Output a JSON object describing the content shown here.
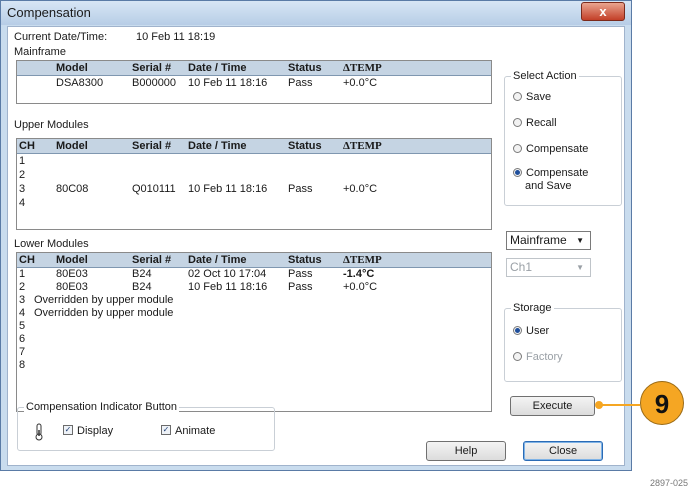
{
  "window": {
    "title": "Compensation",
    "close_glyph": "x"
  },
  "current_datetime": {
    "label": "Current Date/Time:",
    "value": "10 Feb 11 18:19"
  },
  "mainframe": {
    "label": "Mainframe",
    "headers": [
      "Model",
      "Serial #",
      "Date / Time",
      "Status",
      "ΔTEMP"
    ],
    "row": {
      "model": "DSA8300",
      "serial": "B000000",
      "datetime": "10 Feb 11 18:16",
      "status": "Pass",
      "temp": "+0.0°C"
    }
  },
  "upper_modules": {
    "label": "Upper Modules",
    "headers": [
      "CH",
      "Model",
      "Serial #",
      "Date / Time",
      "Status",
      "ΔTEMP"
    ],
    "rows": [
      {
        "ch": "1",
        "model": "",
        "serial": "",
        "datetime": "",
        "status": "",
        "temp": ""
      },
      {
        "ch": "2",
        "model": "",
        "serial": "",
        "datetime": "",
        "status": "",
        "temp": ""
      },
      {
        "ch": "3",
        "model": "80C08",
        "serial": "Q010111",
        "datetime": "10 Feb 11 18:16",
        "status": "Pass",
        "temp": "+0.0°C"
      },
      {
        "ch": "4",
        "model": "",
        "serial": "",
        "datetime": "",
        "status": "",
        "temp": ""
      }
    ]
  },
  "lower_modules": {
    "label": "Lower Modules",
    "headers": [
      "CH",
      "Model",
      "Serial #",
      "Date / Time",
      "Status",
      "ΔTEMP"
    ],
    "rows": [
      {
        "ch": "1",
        "model": "80E03",
        "serial": "B24",
        "datetime": "02 Oct 10 17:04",
        "status": "Pass",
        "temp": "-1.4°C"
      },
      {
        "ch": "2",
        "model": "80E03",
        "serial": "B24",
        "datetime": "10 Feb 11 18:16",
        "status": "Pass",
        "temp": "+0.0°C"
      },
      {
        "ch": "3",
        "model": "Overridden by upper module",
        "serial": "",
        "datetime": "",
        "status": "",
        "temp": ""
      },
      {
        "ch": "4",
        "model": "Overridden by upper module",
        "serial": "",
        "datetime": "",
        "status": "",
        "temp": ""
      },
      {
        "ch": "5",
        "model": "",
        "serial": "",
        "datetime": "",
        "status": "",
        "temp": ""
      },
      {
        "ch": "6",
        "model": "",
        "serial": "",
        "datetime": "",
        "status": "",
        "temp": ""
      },
      {
        "ch": "7",
        "model": "",
        "serial": "",
        "datetime": "",
        "status": "",
        "temp": ""
      },
      {
        "ch": "8",
        "model": "",
        "serial": "",
        "datetime": "",
        "status": "",
        "temp": ""
      }
    ]
  },
  "select_action": {
    "label": "Select Action",
    "options": [
      {
        "label": "Save",
        "selected": false
      },
      {
        "label": "Recall",
        "selected": false
      },
      {
        "label": "Compensate",
        "selected": false
      },
      {
        "label_line1": "Compensate",
        "label_line2": "and Save",
        "selected": true
      }
    ]
  },
  "target_dropdown": {
    "value": "Mainframe"
  },
  "channel_dropdown": {
    "value": "Ch1",
    "enabled": false
  },
  "storage": {
    "label": "Storage",
    "options": [
      {
        "label": "User",
        "selected": true
      },
      {
        "label": "Factory",
        "selected": false,
        "enabled": false
      }
    ]
  },
  "execute_button": {
    "label": "Execute"
  },
  "indicator": {
    "label": "Compensation Indicator Button",
    "icon": "thermometer-icon",
    "display_label": "Display",
    "display_checked": true,
    "animate_label": "Animate",
    "animate_checked": true
  },
  "help_button": {
    "label": "Help"
  },
  "close_button": {
    "label": "Close"
  },
  "callout": {
    "number": "9",
    "color": "#f5a623"
  },
  "figure_id": "2897-025"
}
